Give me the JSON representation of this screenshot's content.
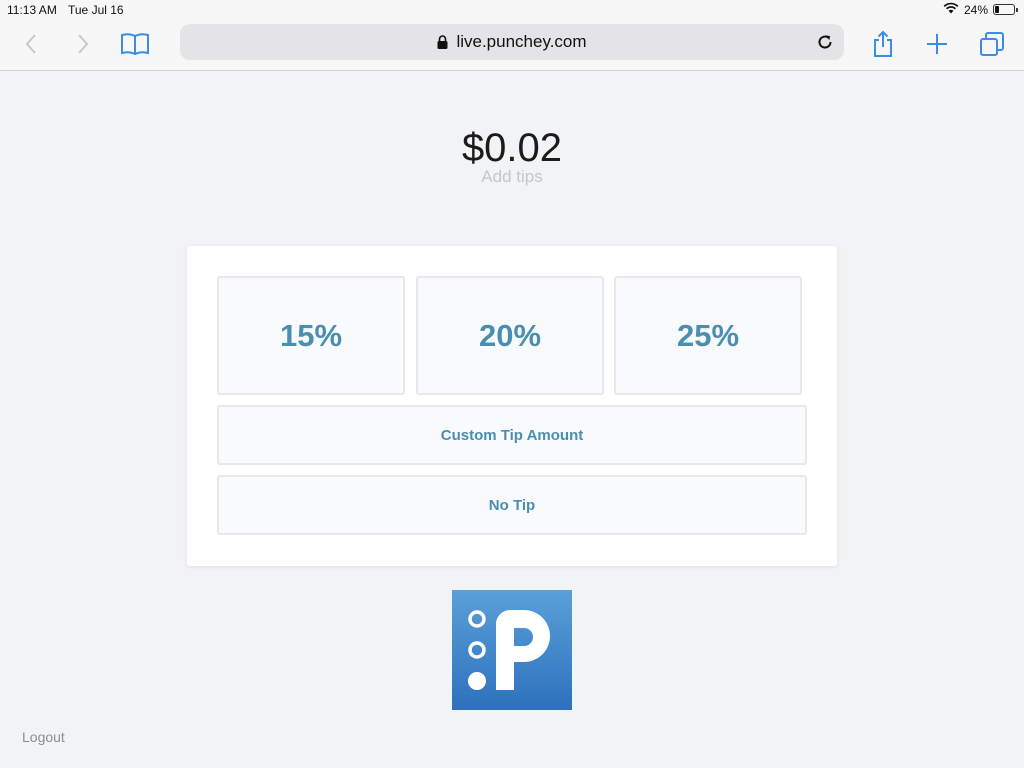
{
  "status_bar": {
    "time": "11:13 AM",
    "date": "Tue Jul 16",
    "battery": "24%",
    "battery_level": 0.24,
    "icons": [
      "wifi-icon",
      "battery-icon"
    ]
  },
  "browser": {
    "url": "live.punchey.com",
    "icons": [
      "back-icon",
      "forward-icon",
      "bookmarks-icon",
      "lock-icon",
      "reload-icon",
      "share-icon",
      "new-tab-icon",
      "tabs-icon"
    ],
    "accent_color": "#3a8ee6"
  },
  "main": {
    "amount": "$0.02",
    "subtitle": "Add tips"
  },
  "tip_card": {
    "options": [
      {
        "label": "15%"
      },
      {
        "label": "20%"
      },
      {
        "label": "25%"
      }
    ],
    "custom_label": "Custom Tip Amount",
    "no_tip_label": "No Tip",
    "button_text_color": "#4a8fb0"
  },
  "footer": {
    "logo": "punchey-logo",
    "logout": "Logout"
  }
}
